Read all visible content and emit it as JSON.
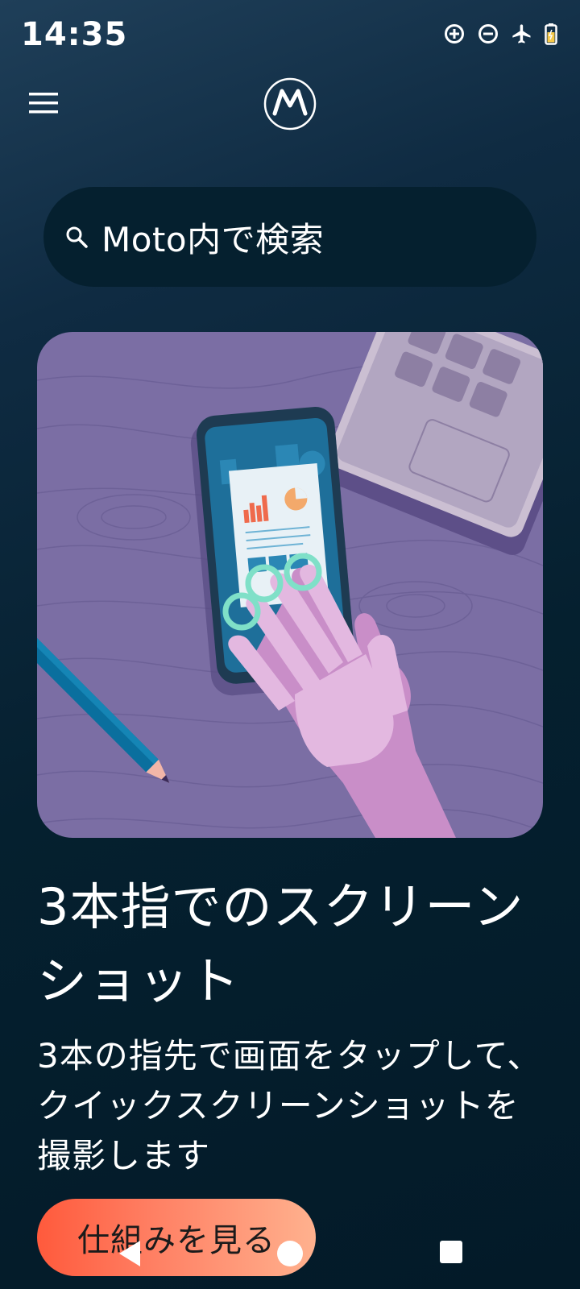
{
  "status_bar": {
    "time": "14:35",
    "icons": [
      "data-saver-icon",
      "do-not-disturb-icon",
      "airplane-mode-icon",
      "battery-charging-icon"
    ]
  },
  "header": {
    "menu_icon": "hamburger-menu-icon",
    "logo": "motorola-logo"
  },
  "search": {
    "icon": "search-icon",
    "placeholder": "Moto内で検索"
  },
  "feature": {
    "title": "3本指でのスクリーンショット",
    "description": "3本の指先で画面をタップして、クイックスクリーンショットを撮影します",
    "cta_label": "仕組みを見る"
  },
  "nav_bar": {
    "buttons": [
      "back-icon",
      "home-icon",
      "recents-icon"
    ]
  },
  "colors": {
    "background_top": "#1f3f59",
    "background_bottom": "#031a28",
    "search_bg": "#05202f",
    "card_bg": "#7b6ea4",
    "cta_start": "#ff5a3c",
    "cta_end": "#ffb18e"
  }
}
